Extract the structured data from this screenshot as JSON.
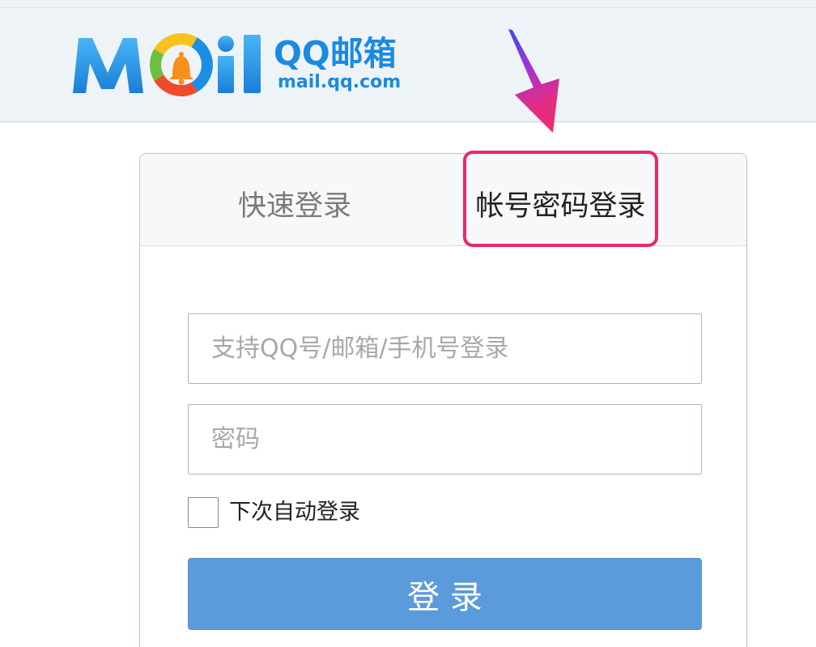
{
  "header": {
    "logo": {
      "wordmark": "MOil",
      "product_name": "QQ邮箱",
      "domain": "mail.qq.com"
    }
  },
  "login_panel": {
    "tabs": [
      {
        "label": "快速登录",
        "active": false
      },
      {
        "label": "帐号密码登录",
        "active": true
      }
    ],
    "account_input": {
      "placeholder": "支持QQ号/邮箱/手机号登录",
      "value": ""
    },
    "password_input": {
      "placeholder": "密码",
      "value": ""
    },
    "remember_me": {
      "label": "下次自动登录",
      "checked": false
    },
    "login_button": {
      "label": "登 录"
    }
  },
  "colors": {
    "brand_blue": "#1b8ae0",
    "button_blue": "#5c9bdb",
    "annotation_pink": "#e8286f",
    "header_background": "#eef3f7"
  },
  "icons": {
    "logo_ring": "qq-mail-bell-ring-icon",
    "annotation_arrow": "arrow-down-icon"
  }
}
